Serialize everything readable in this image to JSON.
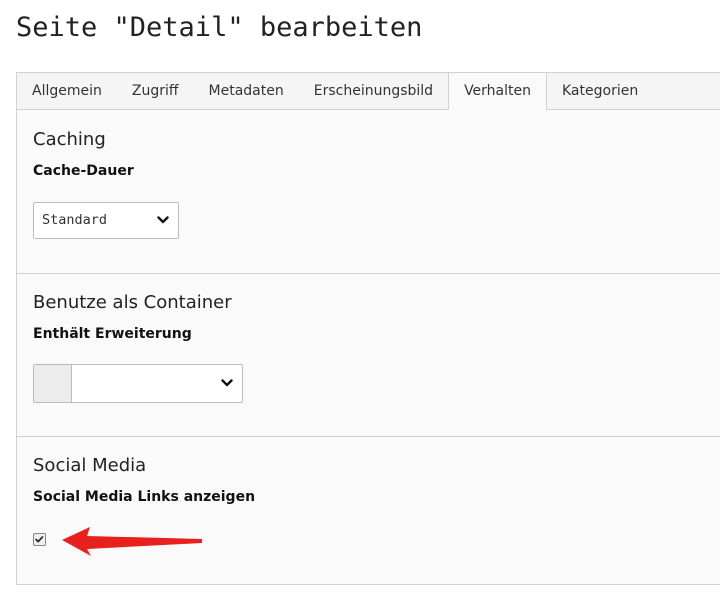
{
  "page": {
    "title": "Seite \"Detail\" bearbeiten"
  },
  "tabs": [
    {
      "label": "Allgemein",
      "active": false
    },
    {
      "label": "Zugriff",
      "active": false
    },
    {
      "label": "Metadaten",
      "active": false
    },
    {
      "label": "Erscheinungsbild",
      "active": false
    },
    {
      "label": "Verhalten",
      "active": true
    },
    {
      "label": "Kategorien",
      "active": false
    }
  ],
  "sections": {
    "caching": {
      "title": "Caching",
      "field_label": "Cache-Dauer",
      "select_value": "Standard"
    },
    "container": {
      "title": "Benutze als Container",
      "field_label": "Enthält Erweiterung",
      "select_value": ""
    },
    "social": {
      "title": "Social Media",
      "field_label": "Social Media Links anzeigen",
      "checked": true
    }
  },
  "icons": {
    "dropdown": "chevron-down-icon",
    "checkmark": "checkmark-icon",
    "annotation": "arrow-icon"
  },
  "colors": {
    "annotation_arrow": "#e8201e",
    "active_tab_bg": "#fafafa",
    "tab_bar_bg": "#f5f5f5",
    "border": "#d2d2d2"
  }
}
